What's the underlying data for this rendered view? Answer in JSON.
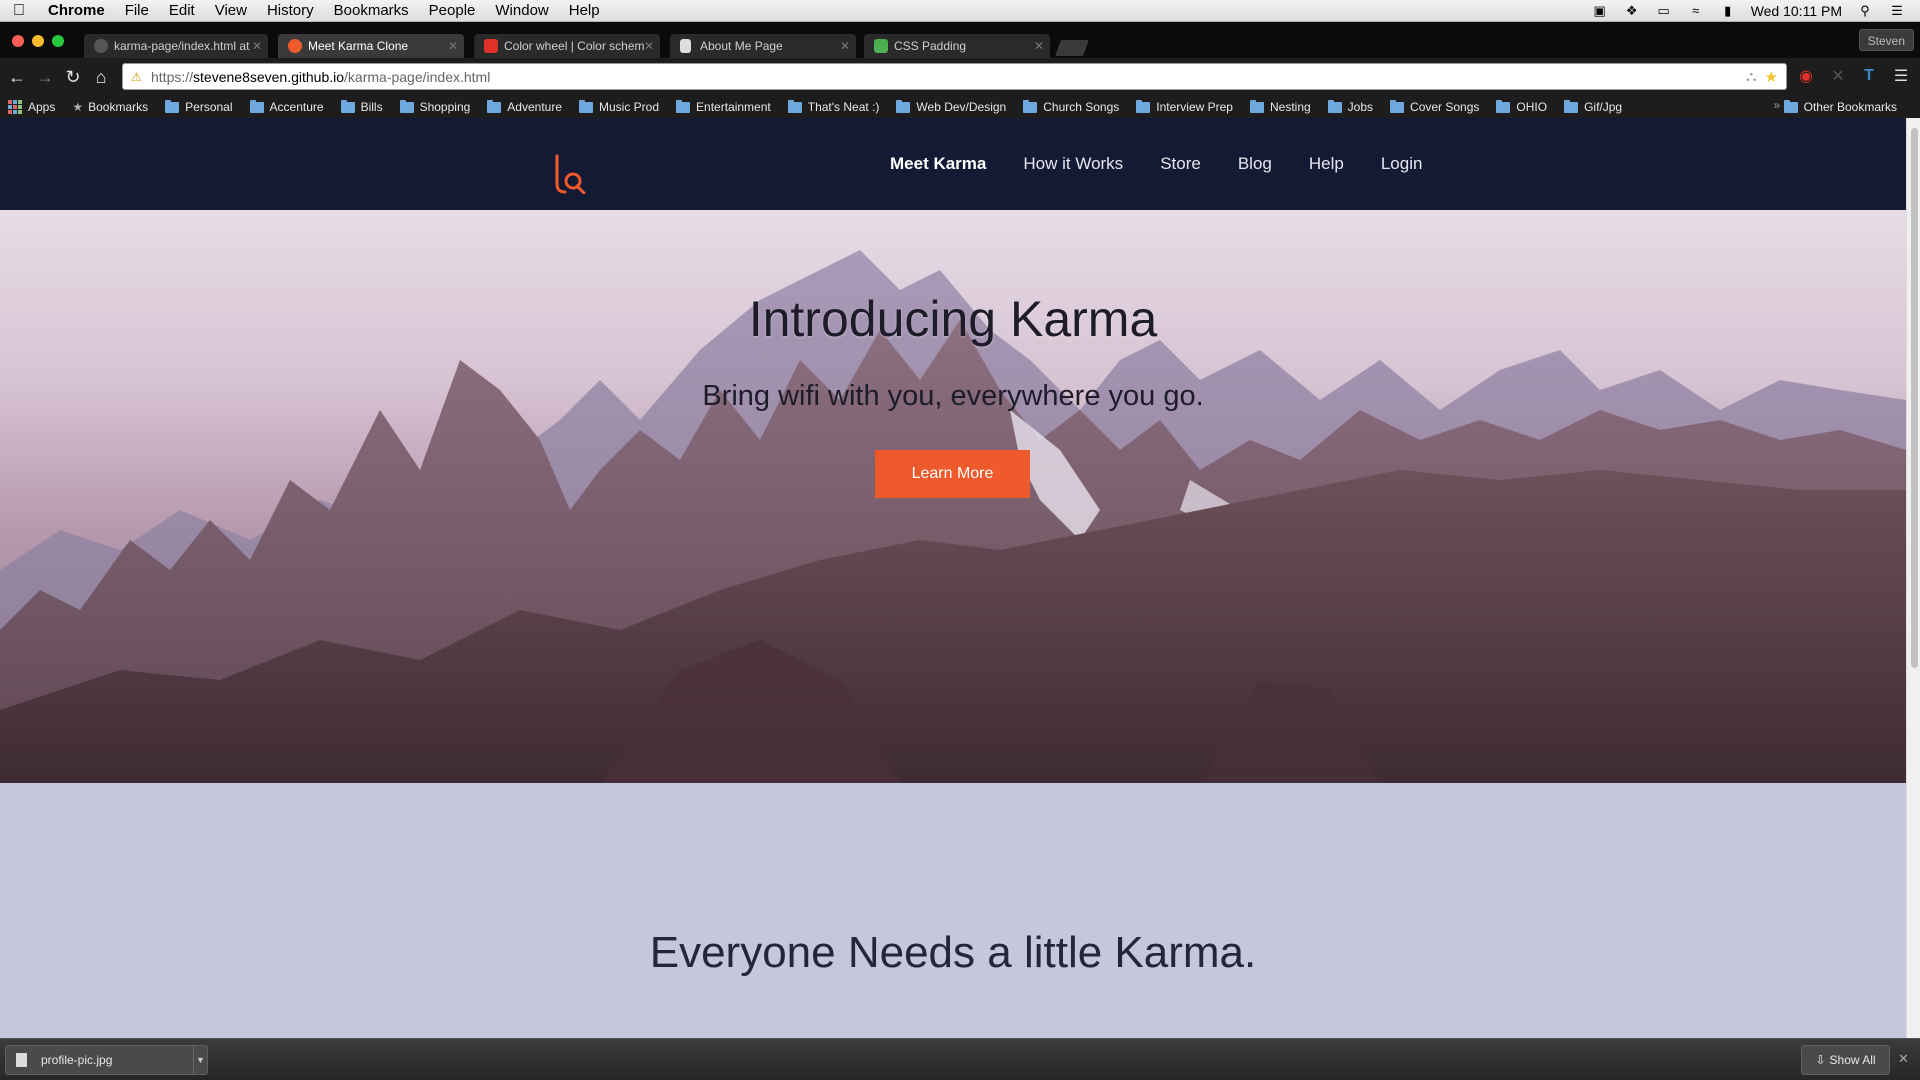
{
  "menubar": {
    "app_name": "Chrome",
    "items": [
      "File",
      "Edit",
      "View",
      "History",
      "Bookmarks",
      "People",
      "Window",
      "Help"
    ],
    "clock": "Wed 10:11 PM"
  },
  "tabs": [
    {
      "title": "karma-page/index.html at",
      "icon": "github-icon",
      "color": "#555555"
    },
    {
      "title": "Meet Karma Clone",
      "icon": "karma-favicon-icon",
      "color": "#ee5a2b"
    },
    {
      "title": "Color wheel | Color schem",
      "icon": "adobe-icon",
      "color": "#e0322a"
    },
    {
      "title": "About Me Page",
      "icon": "document-icon",
      "color": "#dddddd"
    },
    {
      "title": "CSS Padding",
      "icon": "w3schools-icon",
      "color": "#4caf50"
    }
  ],
  "active_tab_index": 1,
  "profile_name": "Steven",
  "address_bar": {
    "scheme": "https://",
    "host": "stevene8seven.github.io",
    "path": "/karma-page/index.html"
  },
  "bookmarks": {
    "apps_label": "Apps",
    "star_label": "Bookmarks",
    "folders": [
      "Personal",
      "Accenture",
      "Bills",
      "Shopping",
      "Adventure",
      "Music Prod",
      "Entertainment",
      "That's Neat :)",
      "Web Dev/Design",
      "Church Songs",
      "Interview Prep",
      "Nesting",
      "Jobs",
      "Cover Songs",
      "OHIO",
      "Gif/Jpg"
    ],
    "overflow": "»",
    "other": "Other Bookmarks"
  },
  "site": {
    "nav": {
      "links": [
        "Meet Karma",
        "How it Works",
        "Store",
        "Blog",
        "Help",
        "Login"
      ],
      "current": "Meet Karma"
    },
    "hero": {
      "title": "Introducing Karma",
      "subtitle": "Bring wifi with you, everywhere you go.",
      "cta_label": "Learn More"
    },
    "section2_heading": "Everyone Needs a little Karma."
  },
  "colors": {
    "nav_bg": "#141a33",
    "accent": "#ee5a2b",
    "section_bg": "#c5c8dd"
  },
  "download_bar": {
    "file_name": "profile-pic.jpg",
    "show_all_label": "Show All"
  }
}
